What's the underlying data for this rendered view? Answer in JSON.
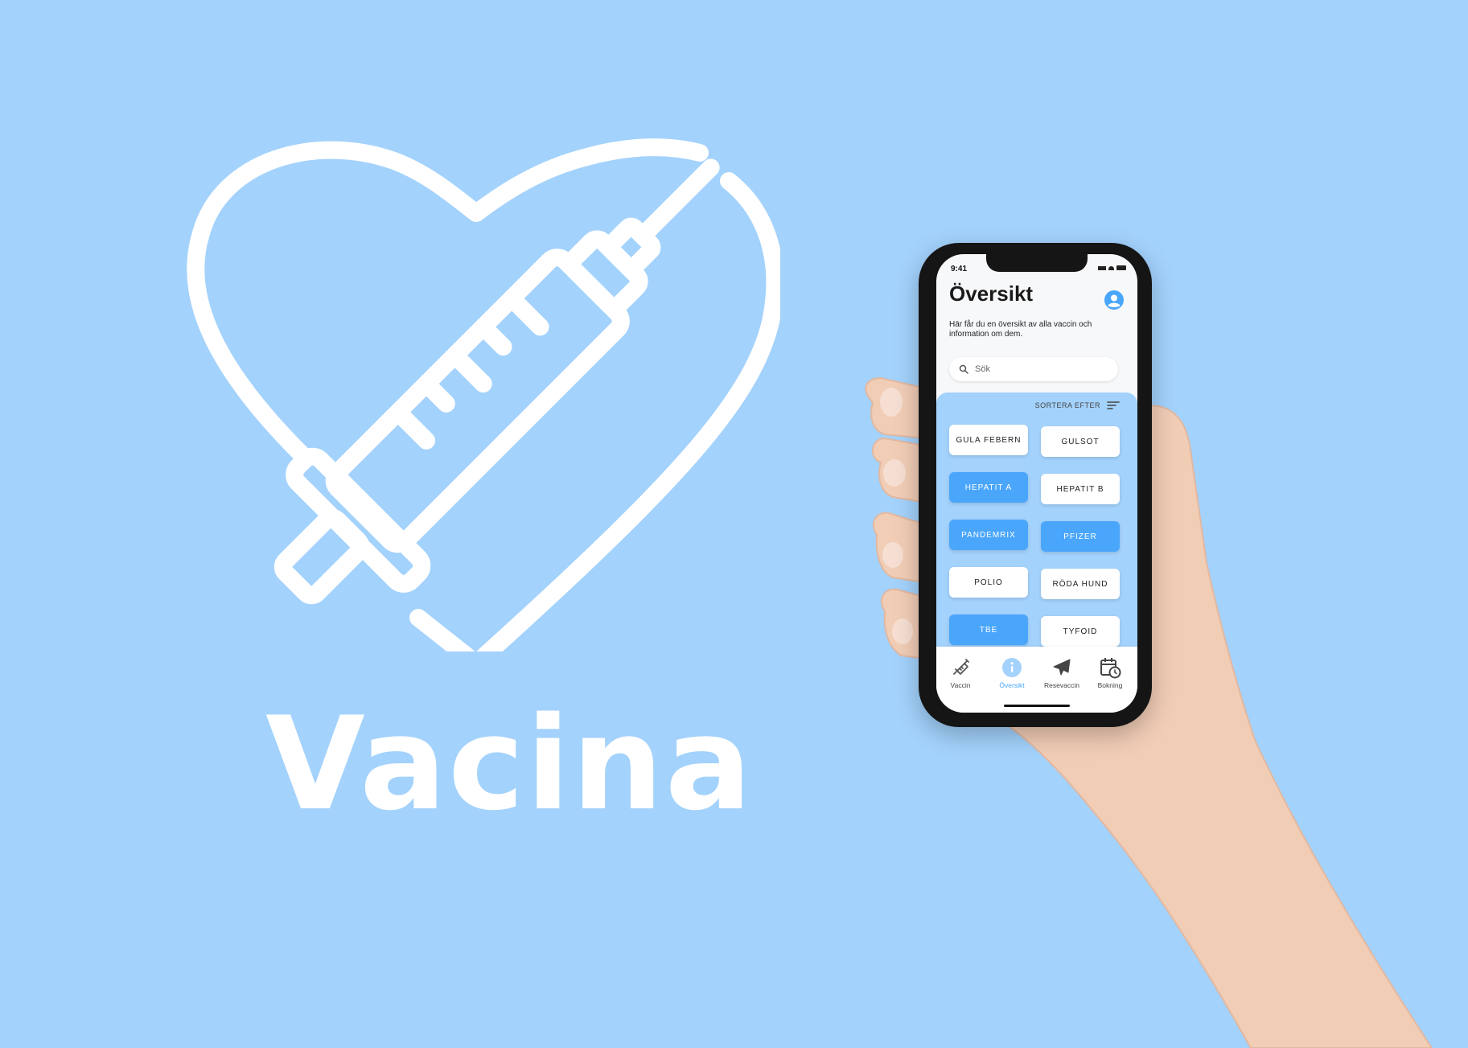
{
  "brand": {
    "name": "Vacina",
    "colors": {
      "background": "#a3d2fc",
      "accent": "#4aa6fb",
      "logo": "#ffffff"
    },
    "logo_icon": "heart-syringe-icon"
  },
  "phone": {
    "status": {
      "time": "9:41"
    },
    "title": "Översikt",
    "subtitle": "Här får du en översikt av alla vaccin och information om dem.",
    "search": {
      "placeholder": "Sök",
      "value": ""
    },
    "sort": {
      "label": "SORTERA EFTER",
      "icon": "sort-lines-icon"
    },
    "vaccines": [
      {
        "label": "GULA FEBERN",
        "style": "white"
      },
      {
        "label": "GULSOT",
        "style": "white"
      },
      {
        "label": "HEPATIT A",
        "style": "blue"
      },
      {
        "label": "HEPATIT B",
        "style": "white"
      },
      {
        "label": "PANDEMRIX",
        "style": "blue"
      },
      {
        "label": "PFIZER",
        "style": "blue"
      },
      {
        "label": "POLIO",
        "style": "white"
      },
      {
        "label": "RÖDA HUND",
        "style": "white"
      },
      {
        "label": "TBE",
        "style": "blue"
      },
      {
        "label": "TYFOID",
        "style": "white"
      }
    ],
    "tabs": [
      {
        "label": "Vaccin",
        "icon": "syringe-icon",
        "active": false
      },
      {
        "label": "Översikt",
        "icon": "info-icon",
        "active": true
      },
      {
        "label": "Resevaccin",
        "icon": "airplane-icon",
        "active": false
      },
      {
        "label": "Bokning",
        "icon": "calendar-clock-icon",
        "active": false
      }
    ]
  }
}
